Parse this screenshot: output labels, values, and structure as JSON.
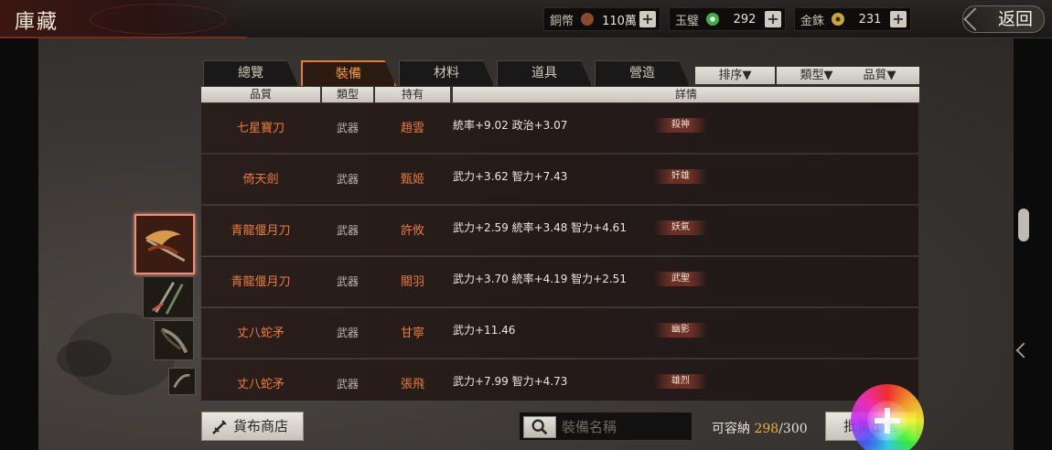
{
  "header": {
    "title": "庫藏",
    "return_label": "返回",
    "currencies": [
      {
        "name": "銅幣",
        "value": "110萬",
        "icon": "copper-coin-icon",
        "color": "#8a4a2e"
      },
      {
        "name": "玉璧",
        "value": "292",
        "icon": "jade-disc-icon",
        "color": "#3fae4a"
      },
      {
        "name": "金銖",
        "value": "231",
        "icon": "gold-coin-icon",
        "color": "#c8a43a"
      }
    ],
    "plus_label": "+"
  },
  "tabs": [
    {
      "label": "總覽",
      "active": false
    },
    {
      "label": "裝備",
      "active": true
    },
    {
      "label": "材料",
      "active": false
    },
    {
      "label": "道具",
      "active": false
    },
    {
      "label": "營造",
      "active": false
    }
  ],
  "filters": [
    {
      "label": "排序▼"
    },
    {
      "label": "類型▼"
    },
    {
      "label": "品質▼"
    }
  ],
  "columns": {
    "quality": "品質",
    "type": "類型",
    "owner": "持有",
    "detail": "詳情"
  },
  "items": [
    {
      "name": "七星寶刀",
      "type": "武器",
      "owner": "趙雲",
      "detail": "統率+9.02  政治+3.07",
      "tag": "殺神"
    },
    {
      "name": "倚天劍",
      "type": "武器",
      "owner": "甄姬",
      "detail": "武力+3.62  智力+7.43",
      "tag": "奸雄"
    },
    {
      "name": "青龍偃月刀",
      "type": "武器",
      "owner": "許攸",
      "detail": "武力+2.59  統率+3.48  智力+4.61",
      "tag": "妖氣"
    },
    {
      "name": "青龍偃月刀",
      "type": "武器",
      "owner": "關羽",
      "detail": "武力+3.70  統率+4.19  智力+2.51",
      "tag": "武聖"
    },
    {
      "name": "丈八蛇矛",
      "type": "武器",
      "owner": "甘寧",
      "detail": "武力+11.46",
      "tag": "幽影"
    },
    {
      "name": "丈八蛇矛",
      "type": "武器",
      "owner": "張飛",
      "detail": "武力+7.99  智力+4.73",
      "tag": "雄烈"
    }
  ],
  "thumbnails": [
    {
      "icon": "crescent-blade-icon",
      "selected": true
    },
    {
      "icon": "dual-swords-icon",
      "selected": false
    },
    {
      "icon": "curved-glaive-icon",
      "selected": false
    },
    {
      "icon": "small-blade-icon",
      "selected": false
    }
  ],
  "footer": {
    "shop_label": "貨布商店",
    "search_placeholder": "裝備名稱",
    "capacity_label": "可容納",
    "capacity_used": "298",
    "capacity_sep": "/",
    "capacity_total": "300",
    "bulk_sell_label": "批量出售"
  },
  "colors": {
    "accent_orange": "#ea7a3a",
    "active_tab_border": "#e07d2e",
    "capacity_highlight": "#f0b135"
  }
}
